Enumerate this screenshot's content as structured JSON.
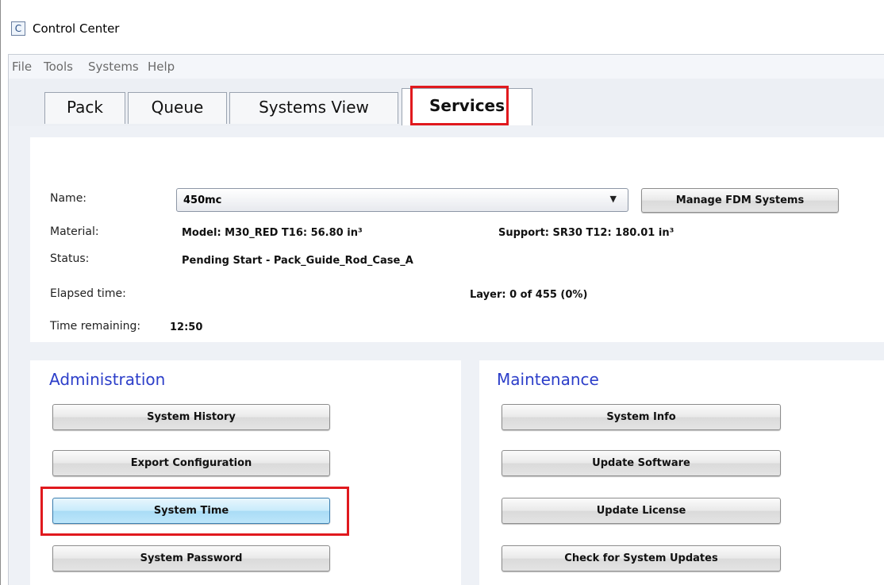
{
  "window": {
    "title": "Control Center",
    "icon": "control-center-app-icon",
    "icon_glyph": "C"
  },
  "menu": {
    "items": [
      "File",
      "Tools",
      "Systems",
      "Help"
    ]
  },
  "tabs": [
    {
      "label": "Pack",
      "active": false
    },
    {
      "label": "Queue",
      "active": false
    },
    {
      "label": "Systems View",
      "active": false
    },
    {
      "label": "Services",
      "active": true
    }
  ],
  "status": {
    "name_label": "Name:",
    "name_value": "450mc",
    "manage_button": "Manage FDM Systems",
    "material_label": "Material:",
    "model_material": "Model: M30_RED  T16: 56.80 in³",
    "support_material": "Support: SR30  T12: 180.01 in³",
    "status_label": "Status:",
    "status_value": "Pending Start - Pack_Guide_Rod_Case_A",
    "elapsed_label": "Elapsed time:",
    "layer_value": "Layer: 0 of 455  (0%)",
    "remaining_label": "Time remaining:",
    "remaining_value": "12:50"
  },
  "administration": {
    "title": "Administration",
    "buttons": [
      "System History",
      "Export Configuration",
      "System Time",
      "System Password"
    ]
  },
  "maintenance": {
    "title": "Maintenance",
    "buttons": [
      "System Info",
      "Update Software",
      "Update License",
      "Check for System Updates"
    ]
  },
  "colors": {
    "highlight": "#e0191e",
    "group_title": "#2c3ec9",
    "focused_button": "#bde6fa"
  }
}
